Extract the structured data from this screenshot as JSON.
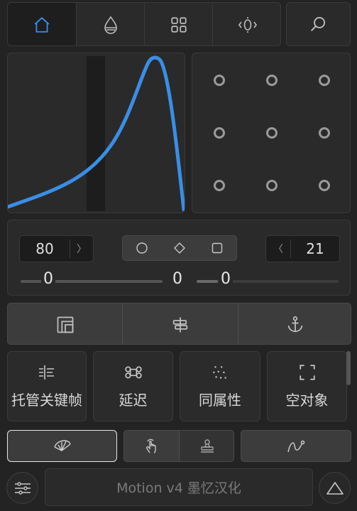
{
  "nav": {
    "tabs": [
      {
        "icon": "home-icon"
      },
      {
        "icon": "drop-icon"
      },
      {
        "icon": "grid-icon"
      },
      {
        "icon": "orbit-icon"
      }
    ],
    "search_icon": "search-icon"
  },
  "curve": {
    "accent": "#3a8ee6"
  },
  "controls": {
    "left_value": "80",
    "right_value": "21",
    "shapes": [
      "circle-icon",
      "diamond-icon",
      "square-icon"
    ],
    "slider_left_value": "0",
    "slider_mid_value": "0",
    "slider_right_value": "0"
  },
  "align_row": {
    "icons": [
      "layers-icon",
      "align-center-icon",
      "anchor-icon"
    ]
  },
  "tools": [
    {
      "label": "托管关键帧",
      "icon": "keyframe-icon"
    },
    {
      "label": "延迟",
      "icon": "command-icon"
    },
    {
      "label": "同属性",
      "icon": "dots-grid-icon"
    },
    {
      "label": "空对象",
      "icon": "frame-corners-icon"
    }
  ],
  "bottom_row": {
    "icons": [
      "fan-icon",
      "touch-icon",
      "stamp-icon",
      "curve-pen-icon"
    ]
  },
  "footer": {
    "title": "Motion v4 墨忆汉化"
  }
}
